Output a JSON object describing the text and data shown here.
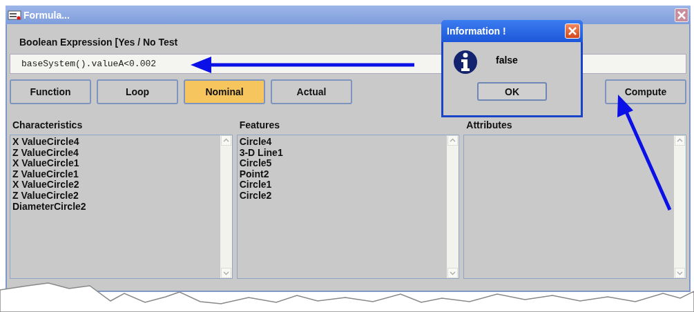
{
  "window": {
    "title": "Formula..."
  },
  "expression": {
    "label": "Boolean Expression [Yes / No Test",
    "value": "baseSystem().valueA<0.002"
  },
  "buttons": [
    {
      "label": "Function",
      "selected": false
    },
    {
      "label": "Loop",
      "selected": false
    },
    {
      "label": "Nominal",
      "selected": true
    },
    {
      "label": "Actual",
      "selected": false
    }
  ],
  "compute_button": "Compute",
  "lists": [
    {
      "heading": "Characteristics",
      "items": [
        "X ValueCircle4",
        "Z ValueCircle4",
        "X ValueCircle1",
        "Z ValueCircle1",
        "X ValueCircle2",
        "Z ValueCircle2",
        "DiameterCircle2"
      ]
    },
    {
      "heading": "Features",
      "items": [
        "Circle4",
        "3-D Line1",
        "Circle5",
        "Point2",
        "Circle1",
        "Circle2"
      ]
    },
    {
      "heading": "Attributes"
    }
  ],
  "dialog": {
    "title": "Information !",
    "message": "false",
    "ok": "OK"
  }
}
